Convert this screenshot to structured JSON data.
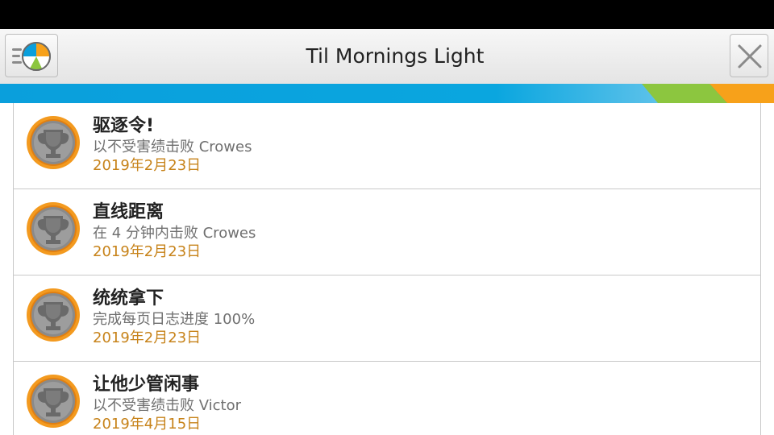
{
  "header": {
    "title": "Til Mornings Light",
    "menu_icon": "menu-globe-icon",
    "close_icon": "close-icon"
  },
  "colors": {
    "strip_blue": "#0a9fdc",
    "strip_green": "#8cc63f",
    "strip_orange": "#f7a11a",
    "date_text": "#c7831a"
  },
  "achievements": [
    {
      "title": "驱逐令!",
      "description": "以不受害绩击败 Crowes",
      "date": "2019年2月23日",
      "icon": "trophy-icon"
    },
    {
      "title": "直线距离",
      "description": "在 4 分钟内击败 Crowes",
      "date": "2019年2月23日",
      "icon": "trophy-icon"
    },
    {
      "title": "统统拿下",
      "description": "完成每页日志进度 100%",
      "date": "2019年2月23日",
      "icon": "trophy-icon"
    },
    {
      "title": "让他少管闲事",
      "description": "以不受害绩击败 Victor",
      "date": "2019年4月15日",
      "icon": "trophy-icon"
    }
  ]
}
